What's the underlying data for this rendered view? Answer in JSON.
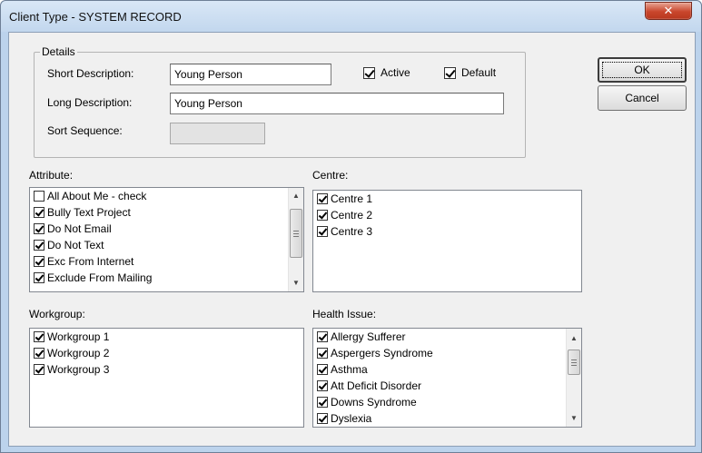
{
  "window": {
    "title": "Client Type - SYSTEM RECORD",
    "close_glyph": "✕"
  },
  "details": {
    "group_label": "Details",
    "short_description_label": "Short Description:",
    "short_description_value": "Young Person",
    "long_description_label": "Long Description:",
    "long_description_value": "Young Person",
    "sort_sequence_label": "Sort Sequence:",
    "sort_sequence_value": "",
    "active_label": "Active",
    "active_checked": true,
    "default_label": "Default",
    "default_checked": true
  },
  "buttons": {
    "ok_label": "OK",
    "cancel_label": "Cancel"
  },
  "attribute": {
    "label": "Attribute:",
    "items": [
      {
        "label": "All About Me - check",
        "checked": false
      },
      {
        "label": "Bully Text Project",
        "checked": true
      },
      {
        "label": "Do Not Email",
        "checked": true
      },
      {
        "label": "Do Not Text",
        "checked": true
      },
      {
        "label": "Exc From Internet",
        "checked": true
      },
      {
        "label": "Exclude From Mailing",
        "checked": true
      }
    ]
  },
  "centre": {
    "label": "Centre:",
    "items": [
      {
        "label": "Centre 1",
        "checked": true
      },
      {
        "label": "Centre 2",
        "checked": true
      },
      {
        "label": "Centre 3",
        "checked": true
      }
    ]
  },
  "workgroup": {
    "label": "Workgroup:",
    "items": [
      {
        "label": "Workgroup 1",
        "checked": true
      },
      {
        "label": "Workgroup 2",
        "checked": true
      },
      {
        "label": "Workgroup 3",
        "checked": true
      }
    ]
  },
  "health_issue": {
    "label": "Health Issue:",
    "items": [
      {
        "label": "Allergy Sufferer",
        "checked": true
      },
      {
        "label": "Aspergers Syndrome",
        "checked": true
      },
      {
        "label": "Asthma",
        "checked": true
      },
      {
        "label": "Att Deficit Disorder",
        "checked": true
      },
      {
        "label": "Downs Syndrome",
        "checked": true
      },
      {
        "label": "Dyslexia",
        "checked": true
      }
    ]
  },
  "icons": {
    "scroll_up": "up-arrow-icon",
    "scroll_down": "down-arrow-icon"
  },
  "colors": {
    "title_bar": "#c2d7ee",
    "close_button": "#c9462c",
    "dialog_face": "#f0f0f0"
  }
}
